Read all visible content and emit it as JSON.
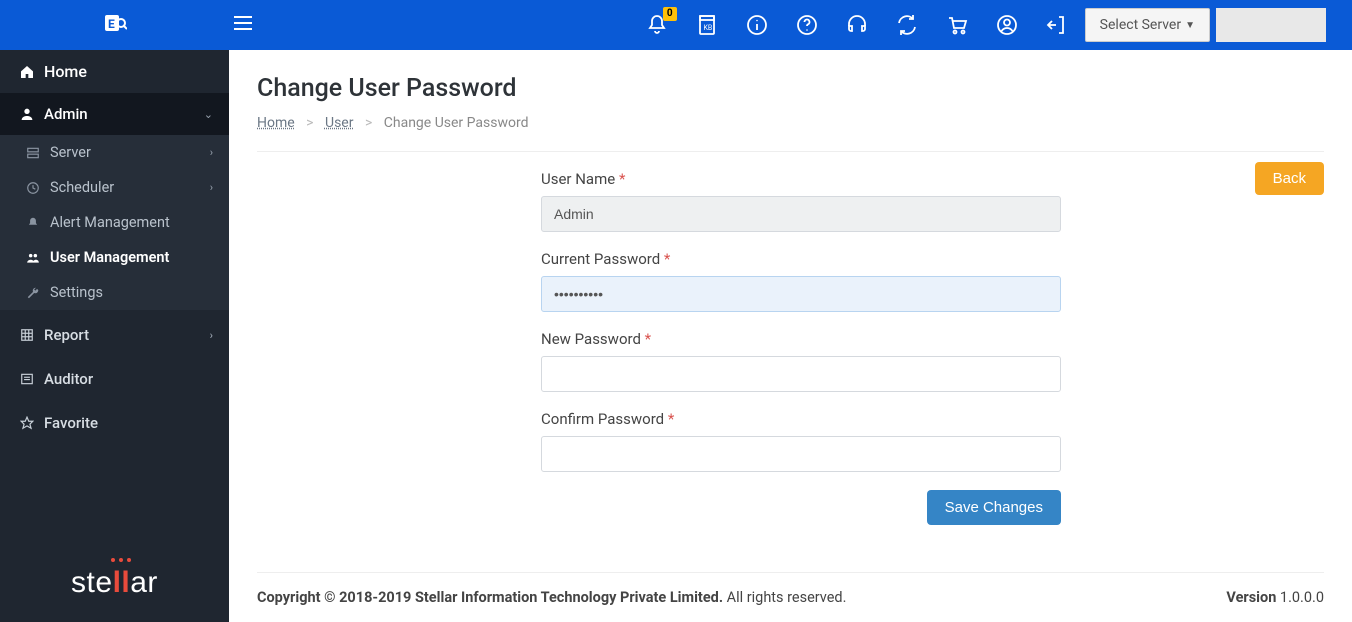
{
  "topbar": {
    "notification_badge": "0",
    "server_select_label": "Select Server"
  },
  "sidebar": {
    "home": "Home",
    "admin": "Admin",
    "items": [
      {
        "label": "Server"
      },
      {
        "label": "Scheduler"
      },
      {
        "label": "Alert Management"
      },
      {
        "label": "User Management"
      },
      {
        "label": "Settings"
      }
    ],
    "report": "Report",
    "auditor": "Auditor",
    "favorite": "Favorite",
    "brand": "stellar"
  },
  "page": {
    "title": "Change User Password",
    "breadcrumb": {
      "home": "Home",
      "user": "User",
      "current": "Change User Password"
    },
    "back_label": "Back",
    "form": {
      "username_label": "User Name",
      "username_value": "Admin",
      "current_pw_label": "Current Password",
      "current_pw_value": "••••••••••",
      "new_pw_label": "New Password",
      "confirm_pw_label": "Confirm Password",
      "save_label": "Save Changes"
    }
  },
  "footer": {
    "copyright_bold": "Copyright © 2018-2019 Stellar Information Technology Private Limited.",
    "copyright_rest": " All rights reserved.",
    "version_label": "Version",
    "version_value": " 1.0.0.0"
  }
}
